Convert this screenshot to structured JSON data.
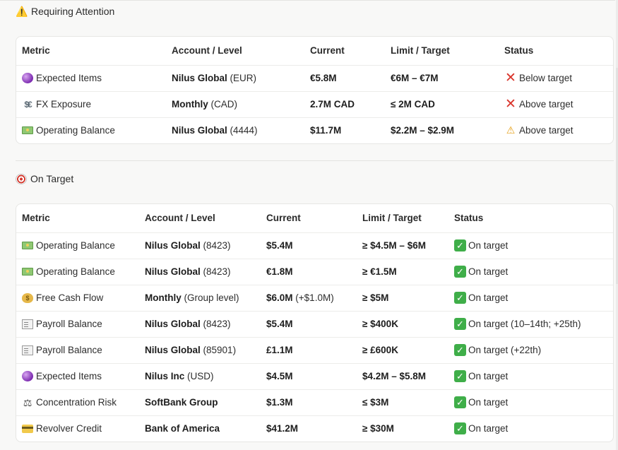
{
  "attention": {
    "icon": "warning-icon",
    "title": "Requiring Attention",
    "headers": [
      "Metric",
      "Account / Level",
      "Current",
      "Limit / Target",
      "Status"
    ],
    "rows": [
      {
        "icon": "crystal-ball-icon",
        "metric": "Expected Items",
        "account": "Nilus Global",
        "account_detail": "(EUR)",
        "current": "€5.8M",
        "current_detail": "",
        "limit": "€6M – €7M",
        "status_icon": "red-x-icon",
        "status": "Below target"
      },
      {
        "icon": "currency-exchange-icon",
        "metric": "FX Exposure",
        "account": "Monthly",
        "account_detail": "(CAD)",
        "current": "2.7M CAD",
        "current_detail": "",
        "limit": "≤ 2M CAD",
        "status_icon": "red-x-icon",
        "status": "Above target"
      },
      {
        "icon": "money-icon",
        "metric": "Operating Balance",
        "account": "Nilus Global",
        "account_detail": "(4444)",
        "current": "$11.7M",
        "current_detail": "",
        "limit": "$2.2M – $2.9M",
        "status_icon": "warning-icon",
        "status": "Above target"
      }
    ]
  },
  "on_target": {
    "icon": "target-icon",
    "title": "On Target",
    "headers": [
      "Metric",
      "Account / Level",
      "Current",
      "Limit / Target",
      "Status"
    ],
    "rows": [
      {
        "icon": "money-icon",
        "metric": "Operating Balance",
        "account": "Nilus Global",
        "account_detail": "(8423)",
        "current": "$5.4M",
        "current_detail": "",
        "limit": "≥ $4.5M – $6M",
        "status_icon": "check-icon",
        "status": "On target"
      },
      {
        "icon": "money-icon",
        "metric": "Operating Balance",
        "account": "Nilus Global",
        "account_detail": "(8423)",
        "current": "€1.8M",
        "current_detail": "",
        "limit": "≥ €1.5M",
        "status_icon": "check-icon",
        "status": "On target"
      },
      {
        "icon": "money-bag-icon",
        "metric": "Free Cash Flow",
        "account": "Monthly",
        "account_detail": "(Group level)",
        "current": "$6.0M",
        "current_detail": "(+$1.0M)",
        "limit": "≥ $5M",
        "status_icon": "check-icon",
        "status": "On target"
      },
      {
        "icon": "receipt-icon",
        "metric": "Payroll Balance",
        "account": "Nilus Global",
        "account_detail": "(8423)",
        "current": "$5.4M",
        "current_detail": "",
        "limit": "≥ $400K",
        "status_icon": "check-icon",
        "status": "On target (10–14th; +25th)"
      },
      {
        "icon": "receipt-icon",
        "metric": "Payroll Balance",
        "account": "Nilus Global",
        "account_detail": "(85901)",
        "current": "£1.1M",
        "current_detail": "",
        "limit": "≥ £600K",
        "status_icon": "check-icon",
        "status": "On target (+22th)"
      },
      {
        "icon": "crystal-ball-icon",
        "metric": "Expected Items",
        "account": "Nilus Inc",
        "account_detail": "(USD)",
        "current": "$4.5M",
        "current_detail": "",
        "limit": "$4.2M – $5.8M",
        "status_icon": "check-icon",
        "status": "On target"
      },
      {
        "icon": "balance-scale-icon",
        "metric": "Concentration Risk",
        "account": "SoftBank Group",
        "account_detail": "",
        "current": "$1.3M",
        "current_detail": "",
        "limit": "≤ $3M",
        "status_icon": "check-icon",
        "status": "On target"
      },
      {
        "icon": "credit-card-icon",
        "metric": "Revolver Credit",
        "account": "Bank of America",
        "account_detail": "",
        "current": "$41.2M",
        "current_detail": "",
        "limit": "≥ $30M",
        "status_icon": "check-icon",
        "status": "On target"
      }
    ]
  }
}
